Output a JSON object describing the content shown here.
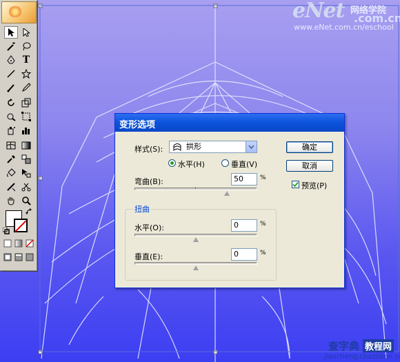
{
  "watermark": {
    "brand": "eNet",
    "chinese": "网络学院",
    "domain": ".com.cn",
    "url": "www.eNet.com.cn/eschool",
    "footer_site": "查字典",
    "footer_tag": "教程网",
    "footer_url": "jiaocheng.chazidian.com"
  },
  "toolbox": {
    "tools": [
      "selection-tool",
      "direct-selection-tool",
      "magic-wand-tool",
      "lasso-tool",
      "pen-tool",
      "type-tool",
      "line-segment-tool",
      "rectangle-tool",
      "paintbrush-tool",
      "pencil-tool",
      "rotate-tool",
      "scale-tool",
      "warp-tool",
      "free-transform-tool",
      "symbol-sprayer-tool",
      "column-graph-tool",
      "mesh-tool",
      "gradient-tool",
      "eyedropper-tool",
      "blend-tool",
      "live-paint-bucket-tool",
      "live-paint-selection-tool",
      "slice-tool",
      "scissors-tool",
      "hand-tool",
      "zoom-tool"
    ],
    "type_glyph": "T"
  },
  "dialog": {
    "title": "变形选项",
    "style_label": "样式(S):",
    "style_value": "拱形",
    "horizontal_label": "水平(H)",
    "vertical_label": "垂直(V)",
    "orientation_selected": "horizontal",
    "bend_label": "弯曲(B):",
    "bend_value": "50",
    "percent": "%",
    "distortion_group": "扭曲",
    "dist_h_label": "水平(O):",
    "dist_h_value": "0",
    "dist_v_label": "垂直(E):",
    "dist_v_value": "0",
    "ok_label": "确定",
    "cancel_label": "取消",
    "preview_label": "预览(P)",
    "preview_checked": true,
    "bend_fraction": 0.75,
    "dist_h_fraction": 0.5,
    "dist_v_fraction": 0.5
  },
  "colors": {
    "canvas_top": "#a89ff0",
    "canvas_bottom": "#3c3ef2",
    "titlebar": "#0b53db",
    "dialog_bg": "#ece9d8"
  }
}
